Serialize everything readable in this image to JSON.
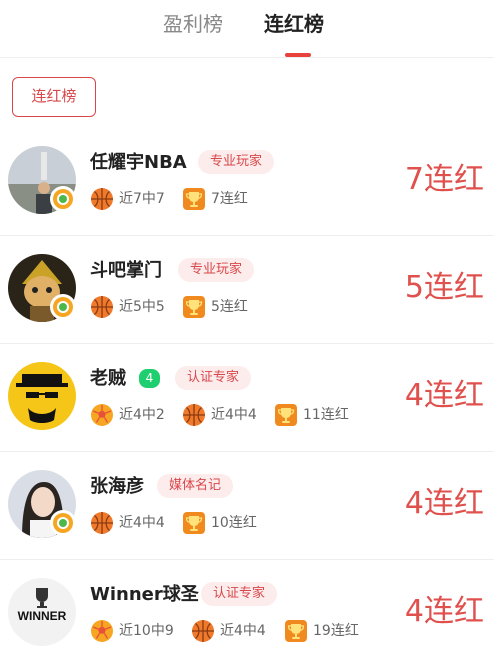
{
  "tabs": [
    {
      "label": "盈利榜",
      "active": false
    },
    {
      "label": "连红榜",
      "active": true
    }
  ],
  "filter_button": {
    "label": "连红榜"
  },
  "colors": {
    "accent": "#e0504d",
    "tag_bg": "#fcecec",
    "rank_badge": "#1fcf6f"
  },
  "experts": [
    {
      "name": "任耀宇NBA",
      "tag": "专业玩家",
      "stats": [
        {
          "icon": "basketball-icon",
          "text": "近7中7"
        },
        {
          "icon": "trophy-icon",
          "text": "7连红"
        }
      ],
      "streak": "7连红"
    },
    {
      "name": "斗吧掌门",
      "tag": "专业玩家",
      "stats": [
        {
          "icon": "basketball-icon",
          "text": "近5中5"
        },
        {
          "icon": "trophy-icon",
          "text": "5连红"
        }
      ],
      "streak": "5连红"
    },
    {
      "name": "老贼",
      "rank": "4",
      "tag": "认证专家",
      "stats": [
        {
          "icon": "football-icon",
          "text": "近4中2"
        },
        {
          "icon": "basketball-icon",
          "text": "近4中4"
        },
        {
          "icon": "trophy-icon",
          "text": "11连红"
        }
      ],
      "streak": "4连红"
    },
    {
      "name": "张海彦",
      "tag": "媒体名记",
      "stats": [
        {
          "icon": "basketball-icon",
          "text": "近4中4"
        },
        {
          "icon": "trophy-icon",
          "text": "10连红"
        }
      ],
      "streak": "4连红"
    },
    {
      "name": "Winner球圣",
      "tag": "认证专家",
      "avatar_text": "WINNER",
      "stats": [
        {
          "icon": "football-icon",
          "text": "近10中9"
        },
        {
          "icon": "basketball-icon",
          "text": "近4中4"
        },
        {
          "icon": "trophy-icon",
          "text": "19连红"
        }
      ],
      "streak": "4连红"
    }
  ]
}
